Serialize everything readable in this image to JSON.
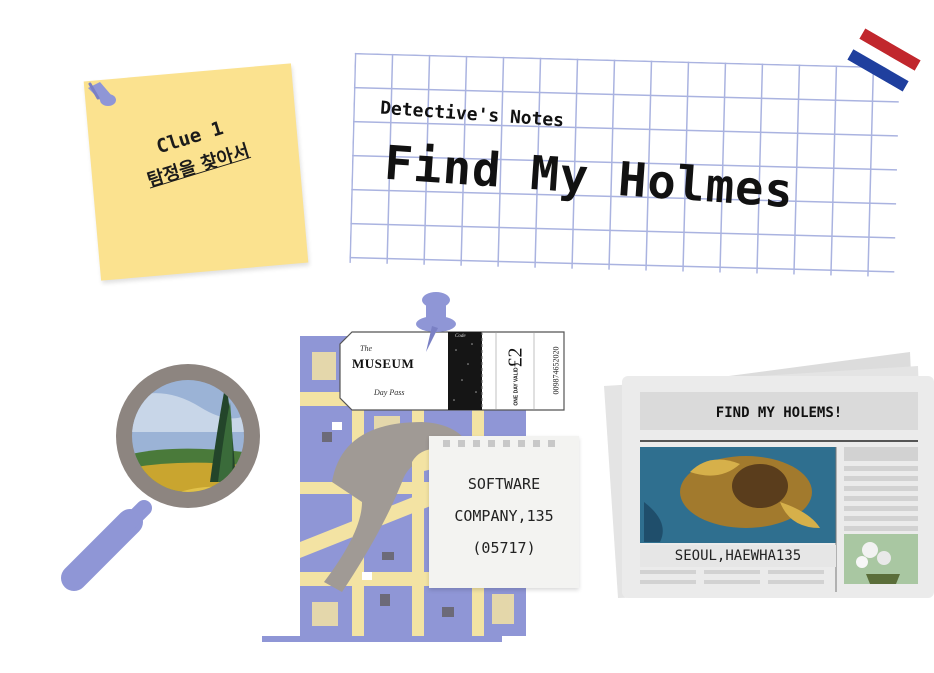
{
  "clue": {
    "title": "Clue 1",
    "subtitle": "탐정을 찾아서"
  },
  "notes": {
    "subtitle": "Detective's Notes",
    "title": "Find My Holmes"
  },
  "ticket": {
    "the": "The",
    "name": "MUSEUM",
    "pass": "Day Pass",
    "price": "£2",
    "validity": "ONE DAY VALID",
    "serial": "009874652020",
    "code": "Code"
  },
  "address": {
    "line1": "SOFTWARE",
    "line2": "COMPANY,135",
    "line3": "(05717)"
  },
  "newspaper": {
    "headline": "FIND MY HOLEMS!",
    "caption": "SEOUL,HAEWHA135"
  },
  "colors": {
    "sticky": "#fbe28f",
    "grid_lines": "#aab3e0",
    "lavender": "#8f96d6",
    "map_road": "#f3e3a3",
    "newspaper": "#e9e9e9"
  },
  "icons": [
    "push-pin-icon",
    "netherlands-flag-icon",
    "magnifying-glass-icon",
    "map-illustration",
    "museum-ticket",
    "newspaper-illustration"
  ]
}
